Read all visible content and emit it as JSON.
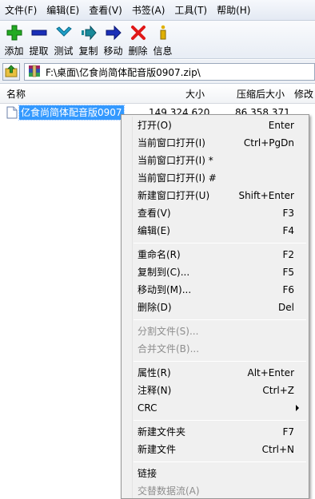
{
  "menubar": {
    "items": [
      {
        "label": "文件(F)"
      },
      {
        "label": "编辑(E)"
      },
      {
        "label": "查看(V)"
      },
      {
        "label": "书签(A)"
      },
      {
        "label": "工具(T)"
      },
      {
        "label": "帮助(H)"
      }
    ]
  },
  "toolbar": {
    "buttons": [
      {
        "label": "添加",
        "icon": "add-icon",
        "color": "#22aa22"
      },
      {
        "label": "提取",
        "icon": "extract-icon",
        "color": "#1a2fb8"
      },
      {
        "label": "测试",
        "icon": "test-icon",
        "color": "#1fa0c8"
      },
      {
        "label": "复制",
        "icon": "copy-icon",
        "color": "#1a8a9a"
      },
      {
        "label": "移动",
        "icon": "move-icon",
        "color": "#1a2fb8"
      },
      {
        "label": "删除",
        "icon": "delete-icon",
        "color": "#e01818"
      },
      {
        "label": "信息",
        "icon": "info-icon",
        "color": "#e0b000"
      }
    ]
  },
  "address": {
    "path": "F:\\桌面\\亿食尚简体配音版0907.zip\\"
  },
  "columns": [
    {
      "label": "名称"
    },
    {
      "label": "大小"
    },
    {
      "label": "压缩后大小"
    },
    {
      "label": "修改"
    }
  ],
  "file": {
    "name": "亿食尚简体配音版0907",
    "size": "149,324,620",
    "packed": "86,358,371"
  },
  "context_menu": {
    "items": [
      {
        "label": "打开(O)",
        "shortcut": "Enter",
        "enabled": true
      },
      {
        "label": "当前窗口打开(I)",
        "shortcut": "Ctrl+PgDn",
        "enabled": true
      },
      {
        "label": "当前窗口打开(I) *",
        "shortcut": "",
        "enabled": true
      },
      {
        "label": "当前窗口打开(I) #",
        "shortcut": "",
        "enabled": true
      },
      {
        "label": "新建窗口打开(U)",
        "shortcut": "Shift+Enter",
        "enabled": true
      },
      {
        "label": "查看(V)",
        "shortcut": "F3",
        "enabled": true
      },
      {
        "label": "编辑(E)",
        "shortcut": "F4",
        "enabled": true
      },
      {
        "label": "重命名(R)",
        "shortcut": "F2",
        "enabled": true
      },
      {
        "label": "复制到(C)...",
        "shortcut": "F5",
        "enabled": true
      },
      {
        "label": "移动到(M)...",
        "shortcut": "F6",
        "enabled": true
      },
      {
        "label": "删除(D)",
        "shortcut": "Del",
        "enabled": true
      },
      {
        "label": "分割文件(S)...",
        "shortcut": "",
        "enabled": false
      },
      {
        "label": "合并文件(B)...",
        "shortcut": "",
        "enabled": false
      },
      {
        "label": "属性(R)",
        "shortcut": "Alt+Enter",
        "enabled": true
      },
      {
        "label": "注释(N)",
        "shortcut": "Ctrl+Z",
        "enabled": true
      },
      {
        "label": "CRC",
        "shortcut": "",
        "enabled": true
      },
      {
        "label": "新建文件夹",
        "shortcut": "F7",
        "enabled": true
      },
      {
        "label": "新建文件",
        "shortcut": "Ctrl+N",
        "enabled": true
      },
      {
        "label": "链接",
        "shortcut": "",
        "enabled": true
      },
      {
        "label": "交替数据流(A)",
        "shortcut": "",
        "enabled": false
      }
    ]
  }
}
